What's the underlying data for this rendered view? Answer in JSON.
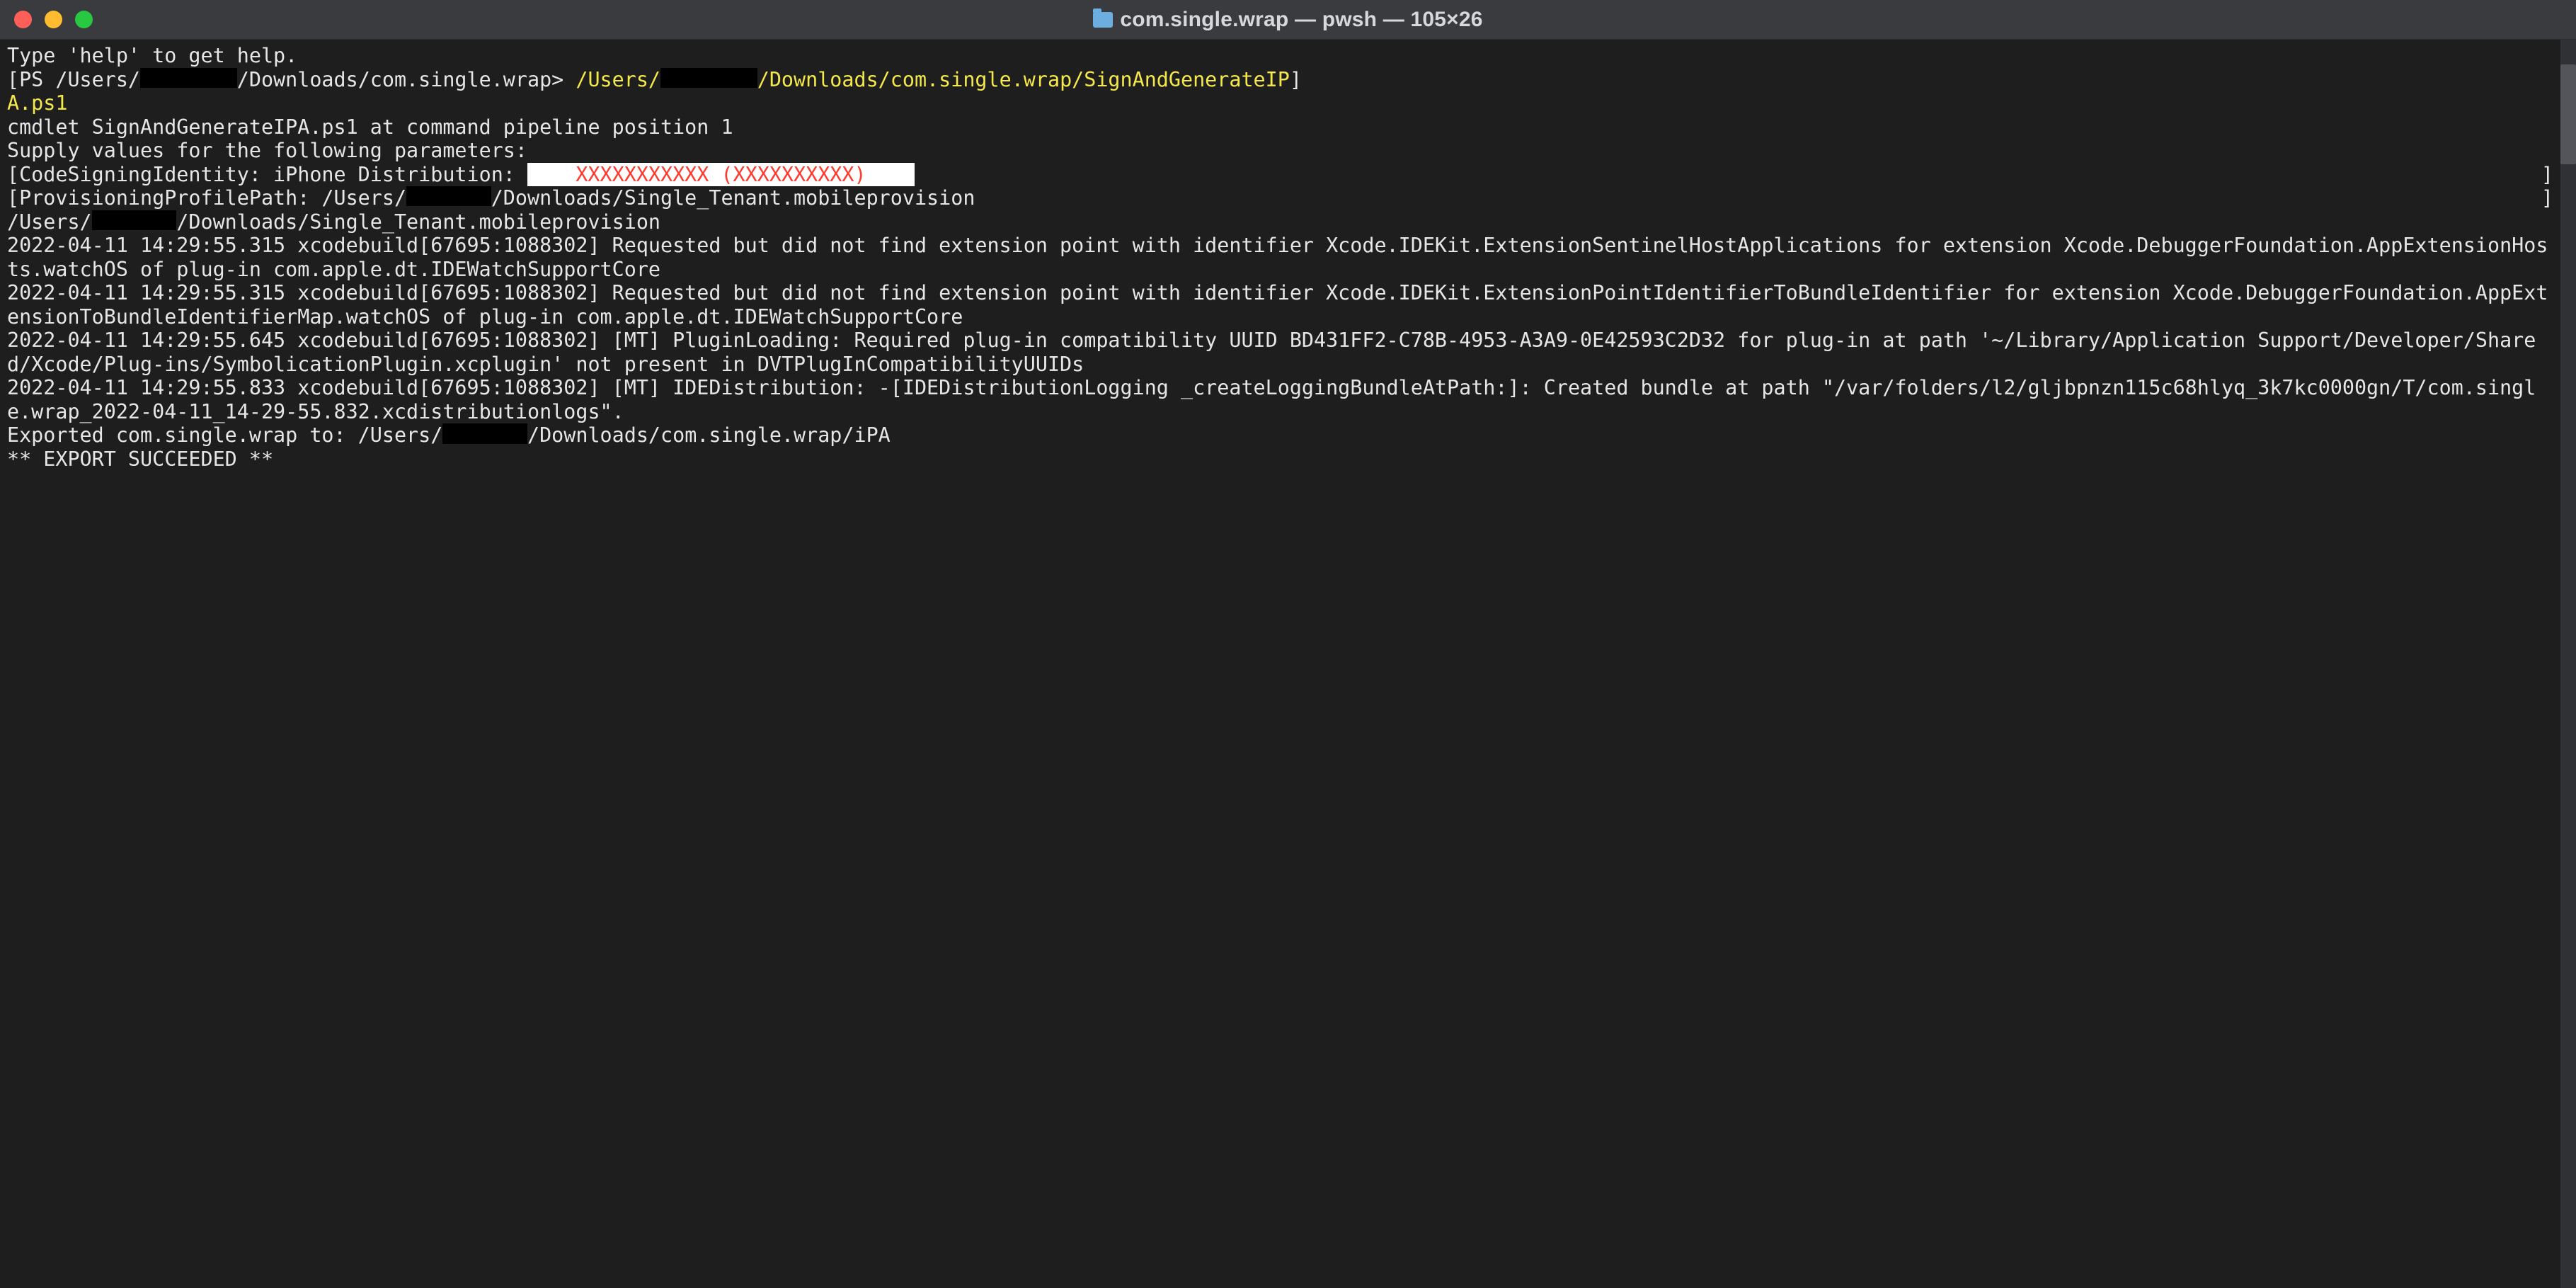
{
  "titlebar": {
    "title": "com.single.wrap — pwsh — 105×26",
    "buttons": {
      "close": "close",
      "minimize": "minimize",
      "maximize": "maximize"
    }
  },
  "term": {
    "help_line": "Type 'help' to get help.",
    "prompt_open": "[",
    "prompt_ps": "PS /Users/",
    "prompt_redact_w": "8ch",
    "prompt_path": "/Downloads/com.single.wrap> ",
    "cmd_part1": "/Users/",
    "cmd_redact_w": "8ch",
    "cmd_part2": "/Downloads/com.single.wrap/SignAndGenerateIP",
    "prompt_close": "]",
    "cmd_line2": "A.ps1",
    "blank": "",
    "l_cmdlet": "cmdlet SignAndGenerateIPA.ps1 at command pipeline position 1",
    "l_supply": "Supply values for the following parameters:",
    "csi_open": "[",
    "csi_label": "CodeSigningIdentity: iPhone Distribution: ",
    "csi_redact_text": "XXXXXXXXXXX (XXXXXXXXXX)",
    "csi_close": "]",
    "ppp_open": "[",
    "ppp_label": "ProvisioningProfilePath: /Users/",
    "ppp_redact_w": "7ch",
    "ppp_tail": "/Downloads/Single_Tenant.mobileprovision",
    "ppp_close": "]",
    "echo_head": "/Users/",
    "echo_redact_w": "7ch",
    "echo_tail": "/Downloads/Single_Tenant.mobileprovision",
    "log1": "2022-04-11 14:29:55.315 xcodebuild[67695:1088302] Requested but did not find extension point with identifier Xcode.IDEKit.ExtensionSentinelHostApplications for extension Xcode.DebuggerFoundation.AppExtensionHosts.watchOS of plug-in com.apple.dt.IDEWatchSupportCore",
    "log2": "2022-04-11 14:29:55.315 xcodebuild[67695:1088302] Requested but did not find extension point with identifier Xcode.IDEKit.ExtensionPointIdentifierToBundleIdentifier for extension Xcode.DebuggerFoundation.AppExtensionToBundleIdentifierMap.watchOS of plug-in com.apple.dt.IDEWatchSupportCore",
    "log3": "2022-04-11 14:29:55.645 xcodebuild[67695:1088302] [MT] PluginLoading: Required plug-in compatibility UUID BD431FF2-C78B-4953-A3A9-0E42593C2D32 for plug-in at path '~/Library/Application Support/Developer/Shared/Xcode/Plug-ins/SymbolicationPlugin.xcplugin' not present in DVTPlugInCompatibilityUUIDs",
    "log4": "2022-04-11 14:29:55.833 xcodebuild[67695:1088302] [MT] IDEDistribution: -[IDEDistributionLogging _createLoggingBundleAtPath:]: Created bundle at path \"/var/folders/l2/gljbpnzn115c68hlyq_3k7kc0000gn/T/com.single.wrap_2022-04-11_14-29-55.832.xcdistributionlogs\".",
    "export_head": "Exported com.single.wrap to: /Users/",
    "export_redact_w": "7ch",
    "export_tail": "/Downloads/com.single.wrap/iPA",
    "succeeded": "** EXPORT SUCCEEDED **"
  },
  "scrollbar": {
    "thumb_top_pct": 2,
    "thumb_height_pct": 8
  }
}
